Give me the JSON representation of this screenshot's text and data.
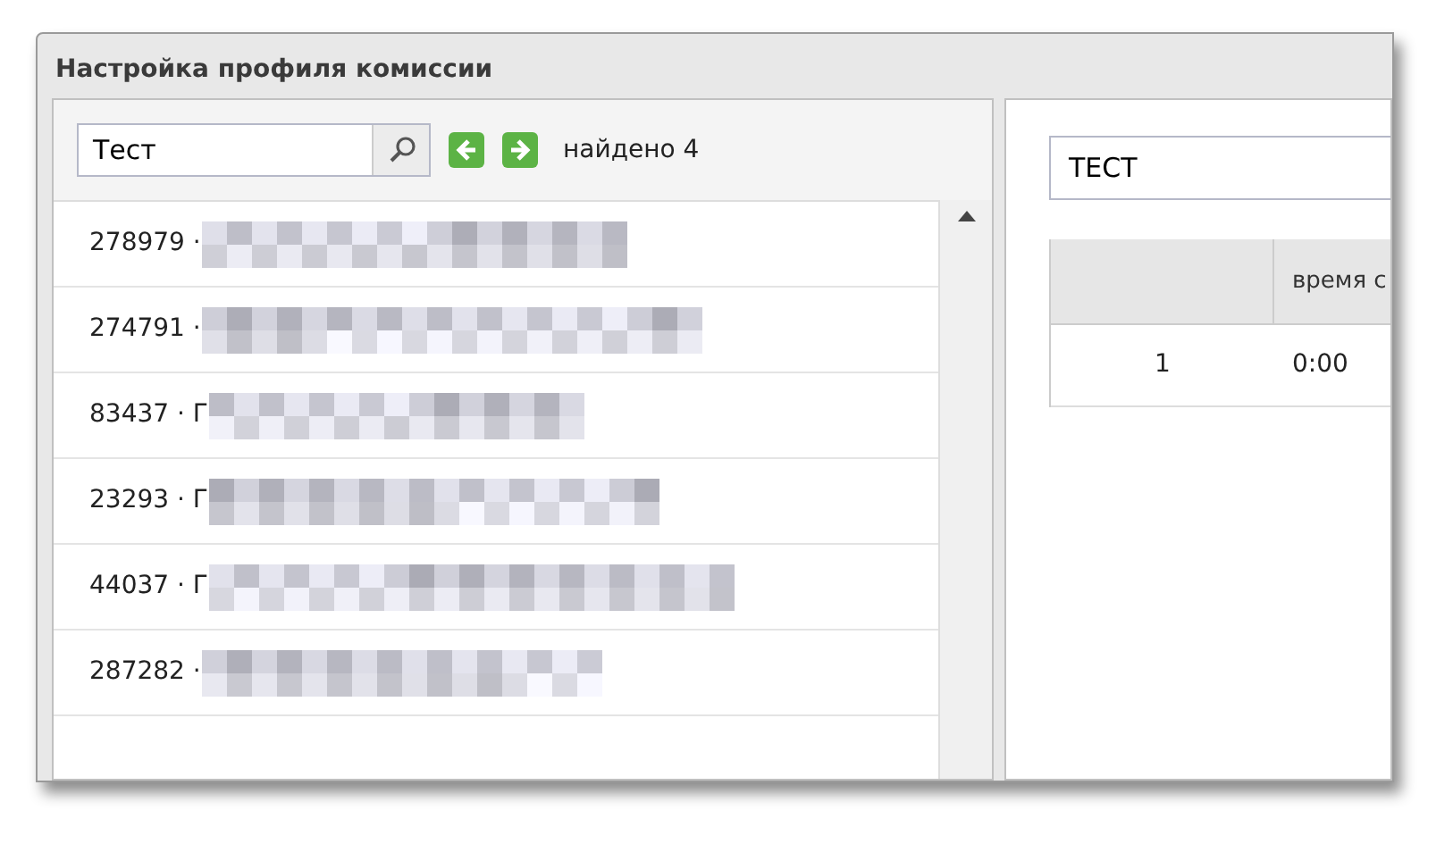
{
  "window": {
    "title": "Настройка профиля комиссии"
  },
  "search": {
    "value": "Тест",
    "found": "найдено 4"
  },
  "list": {
    "items": [
      {
        "label": "278979 ·"
      },
      {
        "label": "274791 ·"
      },
      {
        "label": "83437 · Г"
      },
      {
        "label": "23293 · Г"
      },
      {
        "label": "44037 · Г"
      },
      {
        "label": "287282 ·"
      }
    ]
  },
  "detail": {
    "name_field": {
      "value": "ТЕСТ"
    },
    "table": {
      "columns": [
        "",
        "время с"
      ],
      "rows": [
        [
          "1",
          "0:00"
        ]
      ]
    }
  }
}
